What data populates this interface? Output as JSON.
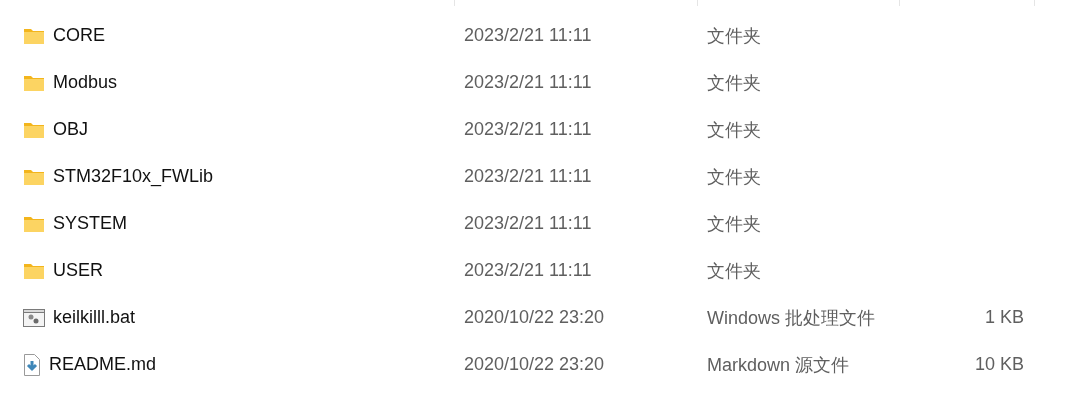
{
  "files": [
    {
      "kind": "folder",
      "name": "CORE",
      "modified": "2023/2/21 11:11",
      "type": "文件夹"
    },
    {
      "kind": "folder",
      "name": "Modbus",
      "modified": "2023/2/21 11:11",
      "type": "文件夹"
    },
    {
      "kind": "folder",
      "name": "OBJ",
      "modified": "2023/2/21 11:11",
      "type": "文件夹"
    },
    {
      "kind": "folder",
      "name": "STM32F10x_FWLib",
      "modified": "2023/2/21 11:11",
      "type": "文件夹"
    },
    {
      "kind": "folder",
      "name": "SYSTEM",
      "modified": "2023/2/21 11:11",
      "type": "文件夹"
    },
    {
      "kind": "folder",
      "name": "USER",
      "modified": "2023/2/21 11:11",
      "type": "文件夹"
    },
    {
      "kind": "batch",
      "name": "keilkilll.bat",
      "modified": "2020/10/22 23:20",
      "type": "Windows 批处理文件",
      "size": "1 KB"
    },
    {
      "kind": "markdown",
      "name": "README.md",
      "modified": "2020/10/22 23:20",
      "type": "Markdown 源文件",
      "size": "10 KB"
    }
  ]
}
